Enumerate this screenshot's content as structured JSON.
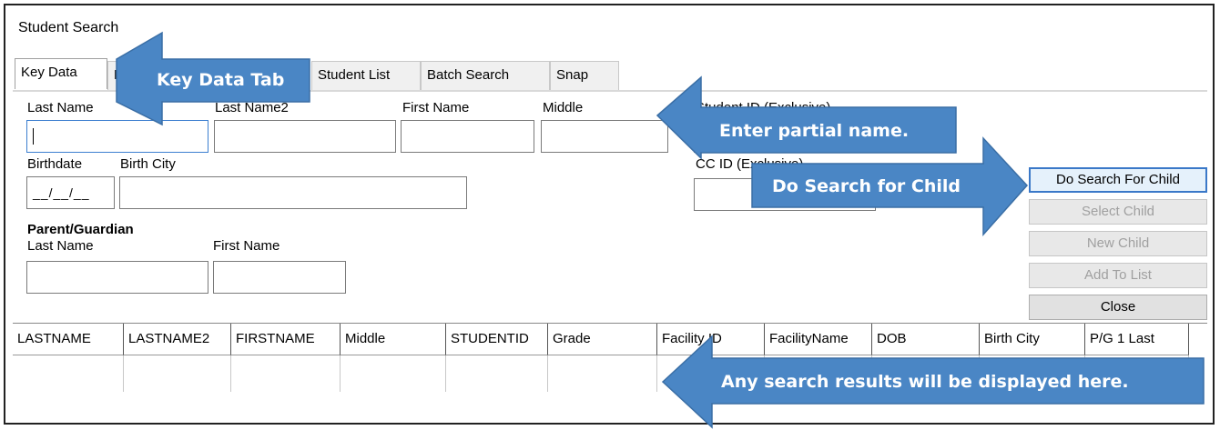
{
  "window": {
    "title": "Student Search"
  },
  "tabs": [
    {
      "label": "Key Data",
      "active": true
    },
    {
      "label": "D",
      "active": false
    },
    {
      "label": "Student List",
      "active": false
    },
    {
      "label": "Batch Search",
      "active": false
    },
    {
      "label": "Snap",
      "active": false
    }
  ],
  "form": {
    "last_name_label": "Last Name",
    "last_name2_label": "Last Name2",
    "first_name_label": "First Name",
    "middle_label": "Middle",
    "student_id_label": "Student ID (Exclusive)",
    "birthdate_label": "Birthdate",
    "birthdate_value": "__/__/__",
    "birth_city_label": "Birth City",
    "cc_id_label": "CC ID (Exclusive)",
    "parent_section_label": "Parent/Guardian",
    "parent_last_name_label": "Last Name",
    "parent_first_name_label": "First Name"
  },
  "buttons": {
    "search": "Do Search For Child",
    "select": "Select Child",
    "new": "New Child",
    "add": "Add To List",
    "close": "Close"
  },
  "results": {
    "columns": [
      "LASTNAME",
      "LASTNAME2",
      "FIRSTNAME",
      "Middle",
      "STUDENTID",
      "Grade",
      "Facility ID",
      "FacilityName",
      "DOB",
      "Birth City",
      "P/G 1 Last"
    ]
  },
  "callouts": {
    "key_data_tab": "Key Data Tab",
    "partial_name": "Enter partial name.",
    "do_search": "Do Search for Child",
    "results": "Any search results will be displayed here."
  },
  "colors": {
    "callout_fill": "#4a86c5",
    "callout_border": "#3a6ea5",
    "focus_border": "#3c7fd0"
  }
}
